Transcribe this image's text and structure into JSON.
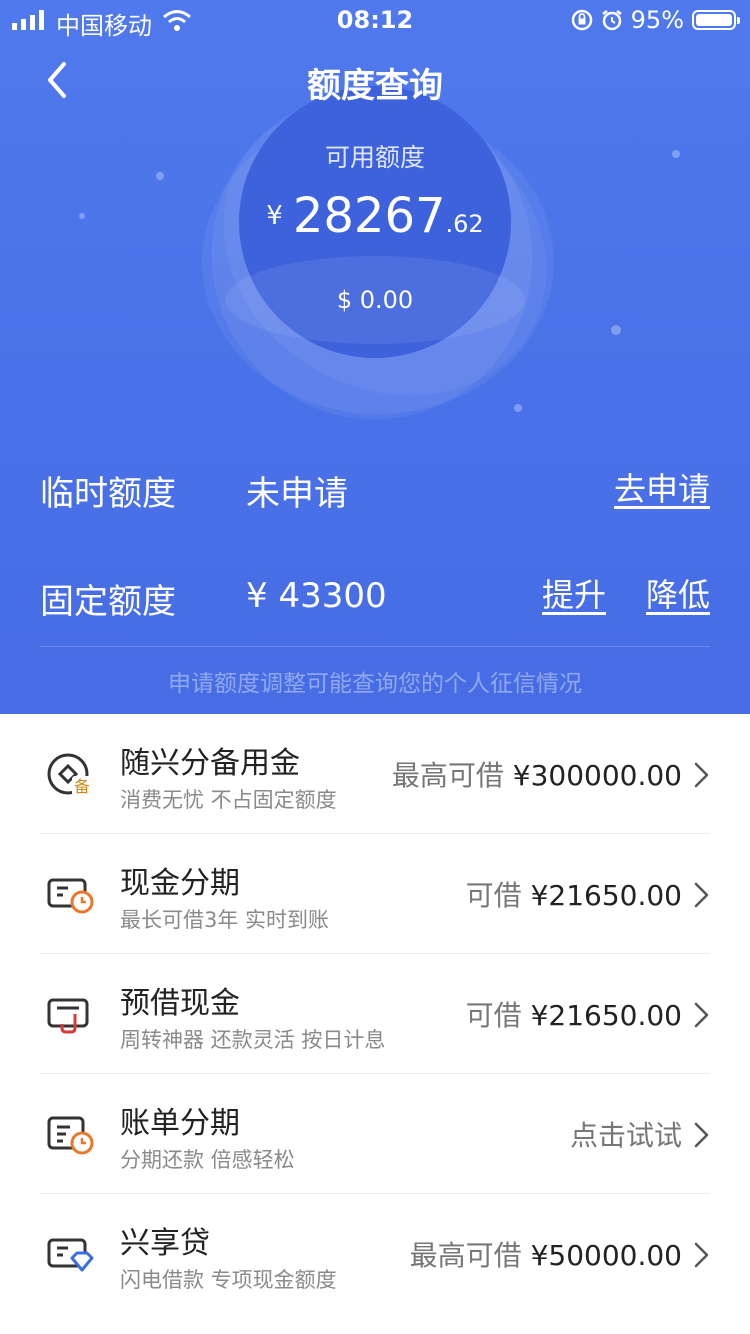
{
  "status_bar": {
    "carrier": "中国移动",
    "time": "08:12",
    "battery": "95%"
  },
  "header": {
    "title": "额度查询"
  },
  "credit": {
    "available_label": "可用额度",
    "currency": "¥",
    "amount_integer": "28267",
    "amount_decimal": ".62",
    "usd_amount": "$ 0.00"
  },
  "temporary": {
    "label": "临时额度",
    "value": "未申请",
    "action": "去申请"
  },
  "fixed": {
    "label": "固定额度",
    "value": "¥ 43300",
    "increase": "提升",
    "decrease": "降低"
  },
  "notice": "申请额度调整可能查询您的个人征信情况",
  "products": [
    {
      "title": "随兴分备用金",
      "subtitle": "消费无忧 不占固定额度",
      "prefix": "最高可借",
      "value": "¥300000.00",
      "icon": "reserve-fund-icon"
    },
    {
      "title": "现金分期",
      "subtitle": "最长可借3年 实时到账",
      "prefix": "可借",
      "value": "¥21650.00",
      "icon": "card-clock-icon"
    },
    {
      "title": "预借现金",
      "subtitle": "周转神器 还款灵活 按日计息",
      "prefix": "可借",
      "value": "¥21650.00",
      "icon": "card-cash-icon"
    },
    {
      "title": "账单分期",
      "subtitle": "分期还款 倍感轻松",
      "prefix": "",
      "value": "点击试试",
      "icon": "bill-clock-icon"
    },
    {
      "title": "兴享贷",
      "subtitle": "闪电借款 专项现金额度",
      "prefix": "最高可借",
      "value": "¥50000.00",
      "icon": "card-diamond-icon"
    }
  ]
}
